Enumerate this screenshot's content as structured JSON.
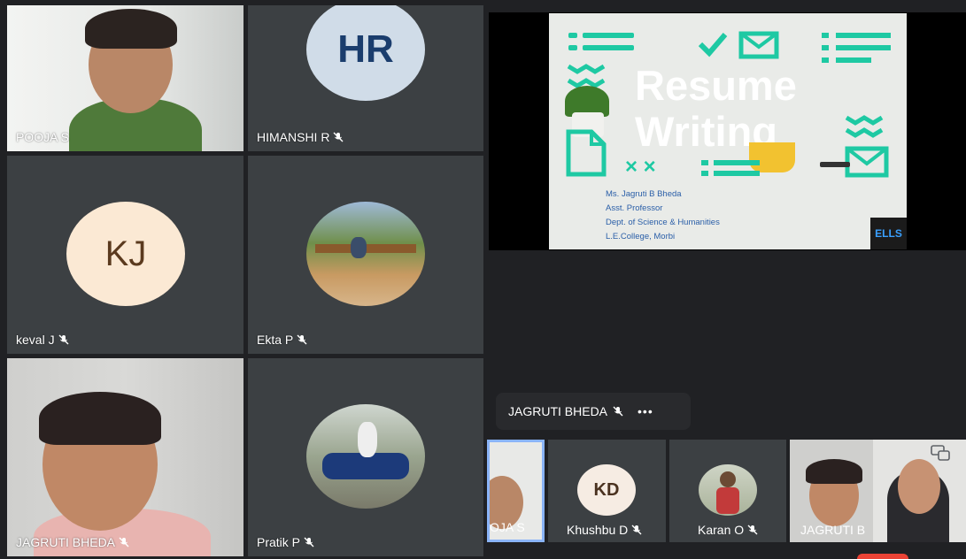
{
  "participants": {
    "pooja": {
      "name": "POOJA S"
    },
    "himanshi": {
      "name": "HIMANSHI R",
      "initials": "HR"
    },
    "keval": {
      "name": "keval J",
      "initials": "KJ"
    },
    "ekta": {
      "name": "Ekta P"
    },
    "jagruti": {
      "name": "JAGRUTI BHEDA"
    },
    "pratik": {
      "name": "Pratik P"
    }
  },
  "presentation": {
    "title_line1": "Resume",
    "title_line2": "Writing",
    "author_lines": [
      "Ms. Jagruti B Bheda",
      "Asst. Professor",
      "Dept. of Science & Humanities",
      "L.E.College, Morbi"
    ],
    "logo_text": "ELLS"
  },
  "presenter_bar": {
    "name": "JAGRUTI BHEDA",
    "more": "•••"
  },
  "strip": {
    "t1": {
      "name": "OJA S"
    },
    "t2": {
      "name": "Khushbu D",
      "initials": "KD"
    },
    "t3": {
      "name": "Karan O"
    },
    "t4": {
      "name": "JAGRUTI B"
    }
  },
  "colors": {
    "background": "#202124",
    "tile": "#3c4043",
    "accent_teal": "#1ec9a3",
    "initials_text": "#1a3d6d",
    "kj_text": "#5b3a1e",
    "active_border": "#8ab4f8",
    "end_call": "#ea4335"
  },
  "icons": {
    "mute": "mic-off-icon",
    "more": "more-options-icon",
    "layout": "layout-icon"
  }
}
